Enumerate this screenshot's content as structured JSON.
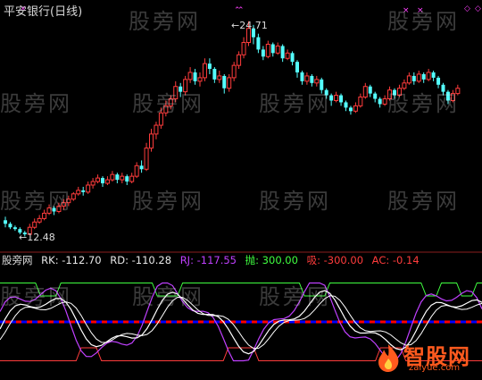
{
  "title": "平安银行(日线)",
  "watermark_text": "股旁网",
  "price_panel": {
    "high_label": "24.71",
    "low_label": "12.48"
  },
  "indicator_panel": {
    "name": "股旁网",
    "rk": "RK: -112.70",
    "rd": "RD: -110.28",
    "rj": "RJ: -117.55",
    "pao": "抛: 300.00",
    "xi": "吸: -300.00",
    "ac": "AC: -0.14"
  },
  "logo": {
    "name": "智股网",
    "url": "zaiyue.com"
  },
  "colors": {
    "up_candle": "#ff3c3c",
    "down_candle": "#54ffff",
    "signal_marker": "#ff40ff",
    "white_line": "#ffffff",
    "magenta_line": "#c040ff",
    "pao_line": "#40ff40",
    "xi_line": "#ff3c3c",
    "blue_dash": "#0000ff",
    "red_dash": "#ff0000"
  },
  "chart_data": {
    "type": "candlestick",
    "candles": [
      [
        13.4,
        13.2,
        13.6,
        13.0
      ],
      [
        13.2,
        13.0,
        13.3,
        12.9
      ],
      [
        13.0,
        12.9,
        13.1,
        12.8
      ],
      [
        12.9,
        12.7,
        13.0,
        12.6
      ],
      [
        12.7,
        12.6,
        12.8,
        12.48
      ],
      [
        12.6,
        13.0,
        13.2,
        12.55
      ],
      [
        13.0,
        13.3,
        13.5,
        12.9
      ],
      [
        13.3,
        13.5,
        13.7,
        13.2
      ],
      [
        13.5,
        13.8,
        14.0,
        13.4
      ],
      [
        13.8,
        14.1,
        14.3,
        13.7
      ],
      [
        14.1,
        13.9,
        14.2,
        13.7
      ],
      [
        13.9,
        14.2,
        14.4,
        13.8
      ],
      [
        14.2,
        14.4,
        14.6,
        14.0
      ],
      [
        14.4,
        14.6,
        14.8,
        14.2
      ],
      [
        14.6,
        14.9,
        15.0,
        14.5
      ],
      [
        14.9,
        15.1,
        15.3,
        14.8
      ],
      [
        15.1,
        15.0,
        15.3,
        14.8
      ],
      [
        15.0,
        15.4,
        15.6,
        14.9
      ],
      [
        15.4,
        15.6,
        15.8,
        15.2
      ],
      [
        15.6,
        15.8,
        16.0,
        15.5
      ],
      [
        15.8,
        15.5,
        15.9,
        15.3
      ],
      [
        15.5,
        15.7,
        15.9,
        15.4
      ],
      [
        15.7,
        16.0,
        16.2,
        15.6
      ],
      [
        16.0,
        15.7,
        16.1,
        15.5
      ],
      [
        15.7,
        15.9,
        16.1,
        15.5
      ],
      [
        15.9,
        15.6,
        16.0,
        15.4
      ],
      [
        15.6,
        15.9,
        16.1,
        15.5
      ],
      [
        15.9,
        16.5,
        16.7,
        15.8
      ],
      [
        16.5,
        16.3,
        16.8,
        16.1
      ],
      [
        16.3,
        17.5,
        17.8,
        16.2
      ],
      [
        17.5,
        18.3,
        18.6,
        17.3
      ],
      [
        18.3,
        18.8,
        19.0,
        18.0
      ],
      [
        18.8,
        19.5,
        19.8,
        18.6
      ],
      [
        19.5,
        19.9,
        20.2,
        19.3
      ],
      [
        19.9,
        20.3,
        20.5,
        19.7
      ],
      [
        20.3,
        21.0,
        21.3,
        20.1
      ],
      [
        21.0,
        20.7,
        21.2,
        20.4
      ],
      [
        20.7,
        21.4,
        21.6,
        20.5
      ],
      [
        21.4,
        21.8,
        22.1,
        21.2
      ],
      [
        21.8,
        21.3,
        22.0,
        21.1
      ],
      [
        21.3,
        21.5,
        21.8,
        21.0
      ],
      [
        21.5,
        22.3,
        22.6,
        21.3
      ],
      [
        22.3,
        22.0,
        22.6,
        21.7
      ],
      [
        22.0,
        21.4,
        22.1,
        21.2
      ],
      [
        21.4,
        21.6,
        21.9,
        21.2
      ],
      [
        21.6,
        20.9,
        21.7,
        20.6
      ],
      [
        20.9,
        21.5,
        21.7,
        20.7
      ],
      [
        21.5,
        22.2,
        22.4,
        21.3
      ],
      [
        22.2,
        22.8,
        23.0,
        22.0
      ],
      [
        22.8,
        23.5,
        23.8,
        22.6
      ],
      [
        23.5,
        24.3,
        24.71,
        23.3
      ],
      [
        24.3,
        23.8,
        24.5,
        23.4
      ],
      [
        23.8,
        23.1,
        24.0,
        22.9
      ],
      [
        23.1,
        22.7,
        23.3,
        22.5
      ],
      [
        22.7,
        23.4,
        23.6,
        22.6
      ],
      [
        23.4,
        22.9,
        23.5,
        22.7
      ],
      [
        22.9,
        23.3,
        23.5,
        22.8
      ],
      [
        23.3,
        22.6,
        23.4,
        22.4
      ],
      [
        22.6,
        22.9,
        23.1,
        22.5
      ],
      [
        22.9,
        22.4,
        23.0,
        22.2
      ],
      [
        22.4,
        21.8,
        22.5,
        21.5
      ],
      [
        21.8,
        21.3,
        21.9,
        21.1
      ],
      [
        21.3,
        21.6,
        21.8,
        21.1
      ],
      [
        21.6,
        21.2,
        21.7,
        21.0
      ],
      [
        21.2,
        21.4,
        21.6,
        21.0
      ],
      [
        21.4,
        20.8,
        21.5,
        20.6
      ],
      [
        20.8,
        20.5,
        20.9,
        20.3
      ],
      [
        20.5,
        20.2,
        20.6,
        19.9
      ],
      [
        20.2,
        20.5,
        20.7,
        20.1
      ],
      [
        20.5,
        20.1,
        20.6,
        19.9
      ],
      [
        20.1,
        19.8,
        20.2,
        19.6
      ],
      [
        19.8,
        19.6,
        19.9,
        19.4
      ],
      [
        19.6,
        19.9,
        20.1,
        19.5
      ],
      [
        19.9,
        20.4,
        20.6,
        19.8
      ],
      [
        20.4,
        21.0,
        21.2,
        20.3
      ],
      [
        21.0,
        20.6,
        21.1,
        20.4
      ],
      [
        20.6,
        20.3,
        20.7,
        20.1
      ],
      [
        20.3,
        20.0,
        20.4,
        19.8
      ],
      [
        20.0,
        20.3,
        20.5,
        19.9
      ],
      [
        20.3,
        20.8,
        21.0,
        20.2
      ],
      [
        20.8,
        20.5,
        20.9,
        20.3
      ],
      [
        20.5,
        20.9,
        21.1,
        20.4
      ],
      [
        20.9,
        21.2,
        21.4,
        20.8
      ],
      [
        21.2,
        21.6,
        21.8,
        21.1
      ],
      [
        21.6,
        21.3,
        21.8,
        21.1
      ],
      [
        21.3,
        21.7,
        21.9,
        21.2
      ],
      [
        21.7,
        21.4,
        21.8,
        21.2
      ],
      [
        21.4,
        21.8,
        22.0,
        21.3
      ],
      [
        21.8,
        21.5,
        21.9,
        21.3
      ],
      [
        21.5,
        21.1,
        21.6,
        20.9
      ],
      [
        21.1,
        20.7,
        21.2,
        20.5
      ],
      [
        20.7,
        20.2,
        20.8,
        20.0
      ],
      [
        20.2,
        20.6,
        20.8,
        20.1
      ],
      [
        20.6,
        20.9,
        21.1,
        20.5
      ]
    ],
    "high_label": 24.71,
    "low_label": 12.48
  }
}
